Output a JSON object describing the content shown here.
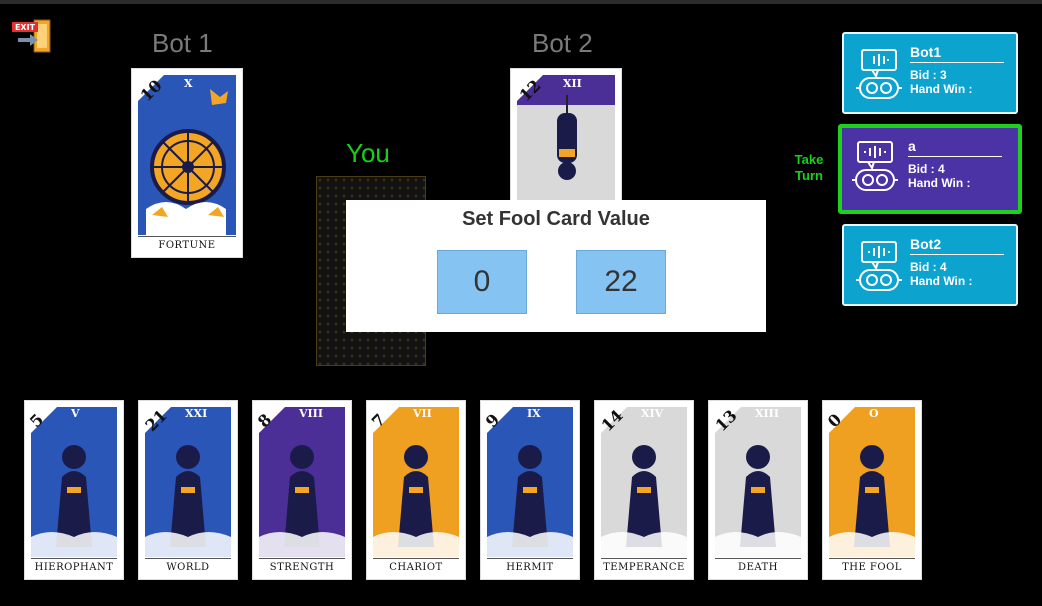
{
  "players": {
    "bot1_label": "Bot 1",
    "bot2_label": "Bot 2",
    "you_label": "You"
  },
  "played_cards": {
    "bot1": {
      "number": "10",
      "roman": "X",
      "name": "FORTUNE"
    },
    "bot2": {
      "number": "12",
      "roman": "XII",
      "name": ""
    }
  },
  "dialog": {
    "title": "Set Fool Card Value",
    "option_low": "0",
    "option_high": "22"
  },
  "scoreboard": [
    {
      "name": "Bot1",
      "bid": "Bid : 3",
      "hand_win": "Hand Win :"
    },
    {
      "name": "a",
      "bid": "Bid : 4",
      "hand_win": "Hand Win :"
    },
    {
      "name": "Bot2",
      "bid": "Bid : 4",
      "hand_win": "Hand Win :"
    }
  ],
  "take_turn": "Take Turn",
  "exit_icon_text": "EXIT",
  "hand": [
    {
      "number": "5",
      "roman": "V",
      "name": "HIEROPHANT",
      "color": "#2a56b8"
    },
    {
      "number": "21",
      "roman": "XXI",
      "name": "WORLD",
      "color": "#2a56b8"
    },
    {
      "number": "8",
      "roman": "VIII",
      "name": "STRENGTH",
      "color": "#4b2f97"
    },
    {
      "number": "7",
      "roman": "VII",
      "name": "CHARIOT",
      "color": "#f0a020"
    },
    {
      "number": "9",
      "roman": "IX",
      "name": "HERMIT",
      "color": "#2a56b8"
    },
    {
      "number": "14",
      "roman": "XIV",
      "name": "TEMPERANCE",
      "color": "#d9d9d9"
    },
    {
      "number": "13",
      "roman": "XIII",
      "name": "DEATH",
      "color": "#d9d9d9"
    },
    {
      "number": "0",
      "roman": "O",
      "name": "THE FOOL",
      "color": "#f0a020"
    }
  ],
  "colors": {
    "panel_bg": "#0ca3cf",
    "active_panel_bg": "#4b33a5",
    "active_border": "#1fd11f",
    "dialog_button": "#85c3f3"
  }
}
